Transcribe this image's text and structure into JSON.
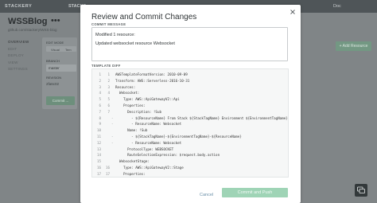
{
  "topbar": {
    "logo": "STACKERY",
    "stacks": "STACKS",
    "user": "Doc"
  },
  "app": {
    "title": "WSSBlog",
    "menu": "•••",
    "subtitle": "github.com/stackery/WSS-blog"
  },
  "sidebar": {
    "items": [
      "OVERVIEW",
      "EDIT",
      "DEPLOY",
      "VIEW",
      "SETTINGS"
    ]
  },
  "edit_panel": {
    "label": "EDIT MODE",
    "visual_tab": "Visual",
    "template_tab": "Tem",
    "branch_label": "BRANCH",
    "branch_value": "master",
    "revision_label": "REVISION",
    "revision_value": "2fa6c02",
    "commit_label": "Commit ..."
  },
  "add_resource": "+ Add Resource",
  "modal": {
    "title": "Review and Commit Changes",
    "message_label": "COMMIT MESSAGE",
    "message_lines": [
      "Modified 1 resource:",
      "Updated websocket resource Websocket"
    ],
    "diff_label": "TEMPLATE DIFF",
    "diff": [
      {
        "n1": "1",
        "n2": "1",
        "mark": "",
        "code": "AWSTemplateFormatVersion: 2010-09-09"
      },
      {
        "n1": "2",
        "n2": "2",
        "mark": "",
        "code": "Transform: AWS::Serverless-2016-10-31"
      },
      {
        "n1": "3",
        "n2": "3",
        "mark": "",
        "code": "Resources:"
      },
      {
        "n1": "4",
        "n2": "4",
        "mark": "",
        "code": "  Websocket:"
      },
      {
        "n1": "5",
        "n2": "5",
        "mark": "",
        "code": "    Type: AWS::ApiGatewayV2::Api"
      },
      {
        "n1": "6",
        "n2": "6",
        "mark": "",
        "code": "    Properties:"
      },
      {
        "n1": "7",
        "n2": "7",
        "mark": "",
        "code": "      Description: !Sub"
      },
      {
        "n1": "8",
        "n2": "",
        "mark": "-",
        "code": "        - ${ResourceName} From Stack ${StackTagName} Environment ${EnvironmentTagName}"
      },
      {
        "n1": "9",
        "n2": "",
        "mark": "-",
        "code": "        - ResourceName: Websocket"
      },
      {
        "n1": "10",
        "n2": "",
        "mark": "",
        "code": "      Name: !Sub"
      },
      {
        "n1": "11",
        "n2": "",
        "mark": "-",
        "code": "        - ${StackTagName}-${EnvironmentTagName}-${ResourceName}"
      },
      {
        "n1": "12",
        "n2": "",
        "mark": "-",
        "code": "        - ResourceName: Websocket"
      },
      {
        "n1": "13",
        "n2": "",
        "mark": "",
        "code": "      ProtocolType: WEBSOCKET"
      },
      {
        "n1": "14",
        "n2": "",
        "mark": "",
        "code": "      RouteSelectionExpression: $request.body.action"
      },
      {
        "n1": "15",
        "n2": "",
        "mark": "",
        "code": "  WebsocketStage:"
      },
      {
        "n1": "16",
        "n2": "16",
        "mark": "",
        "code": "    Type: AWS::ApiGatewayV2::Stage"
      },
      {
        "n1": "17",
        "n2": "17",
        "mark": "",
        "code": "    Properties:"
      }
    ],
    "cancel": "Cancel",
    "commit_push": "Commit and Push"
  },
  "colors": {
    "accent": "#9fd4b6",
    "link": "#6a8fa8",
    "overlay": "#808587"
  }
}
